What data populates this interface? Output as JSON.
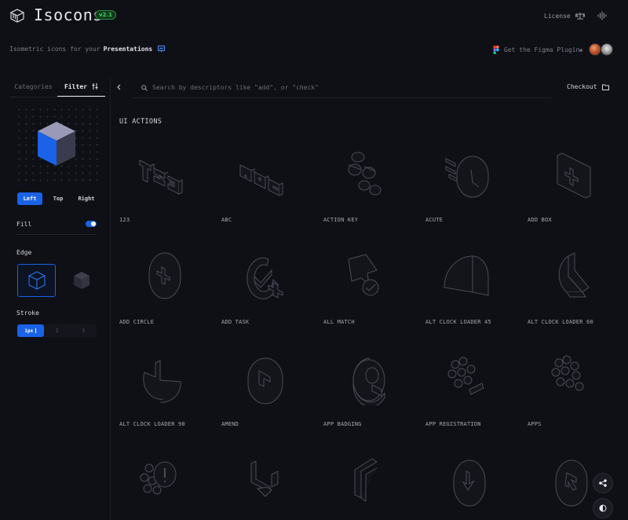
{
  "header": {
    "app_name": "Isocons",
    "version": "v2.1",
    "license_label": "License"
  },
  "tagline": {
    "prefix": "Isometric icons for your",
    "highlight": "Presentations"
  },
  "figma": {
    "label": "Get the Figma Plugin"
  },
  "sidebar": {
    "tabs": [
      {
        "label": "Categories"
      },
      {
        "label": "Filter"
      }
    ],
    "views": [
      "Left",
      "Top",
      "Right"
    ],
    "active_view": "Left",
    "fill_label": "Fill",
    "fill_on": true,
    "edge_label": "Edge",
    "stroke_label": "Stroke",
    "stroke_options": [
      "1px",
      "2",
      "3"
    ],
    "stroke_selected": "1px"
  },
  "search": {
    "placeholder": "Search by descriptors like \"add\", or \"check\""
  },
  "checkout_label": "Checkout",
  "section_title": "UI ACTIONS",
  "icons": [
    {
      "label": "123",
      "icon": "numbers-123-icon"
    },
    {
      "label": "ABC",
      "icon": "letters-abc-icon"
    },
    {
      "label": "ACTION KEY",
      "icon": "action-key-icon"
    },
    {
      "label": "ACUTE",
      "icon": "acute-icon"
    },
    {
      "label": "ADD BOX",
      "icon": "add-box-icon"
    },
    {
      "label": "ADD CIRCLE",
      "icon": "add-circle-icon"
    },
    {
      "label": "ADD TASK",
      "icon": "add-task-icon"
    },
    {
      "label": "ALL MATCH",
      "icon": "all-match-icon"
    },
    {
      "label": "ALT CLOCK LOADER 45",
      "icon": "clock-loader-45-icon"
    },
    {
      "label": "ALT CLOCK LOADER 60",
      "icon": "clock-loader-60-icon"
    },
    {
      "label": "ALT CLOCK LOADER 90",
      "icon": "clock-loader-90-icon"
    },
    {
      "label": "AMEND",
      "icon": "amend-icon"
    },
    {
      "label": "APP BADGING",
      "icon": "app-badging-icon"
    },
    {
      "label": "APP REGISTRATION",
      "icon": "app-registration-icon"
    },
    {
      "label": "APPS",
      "icon": "apps-icon"
    },
    {
      "label": "",
      "icon": "apps-alert-icon"
    },
    {
      "label": "",
      "icon": "arrow-selector-icon"
    },
    {
      "label": "",
      "icon": "corner-arrow-icon"
    },
    {
      "label": "",
      "icon": "arrow-circle-down-icon"
    },
    {
      "label": "",
      "icon": "arrow-circle-icon"
    }
  ],
  "colors": {
    "background": "#0f1016",
    "accent": "#1a62e8",
    "badge_green": "#41d35f",
    "cube_blue": "#1a62e8",
    "cube_top": "#9a9ab8",
    "cube_side": "#3a3b4c"
  }
}
